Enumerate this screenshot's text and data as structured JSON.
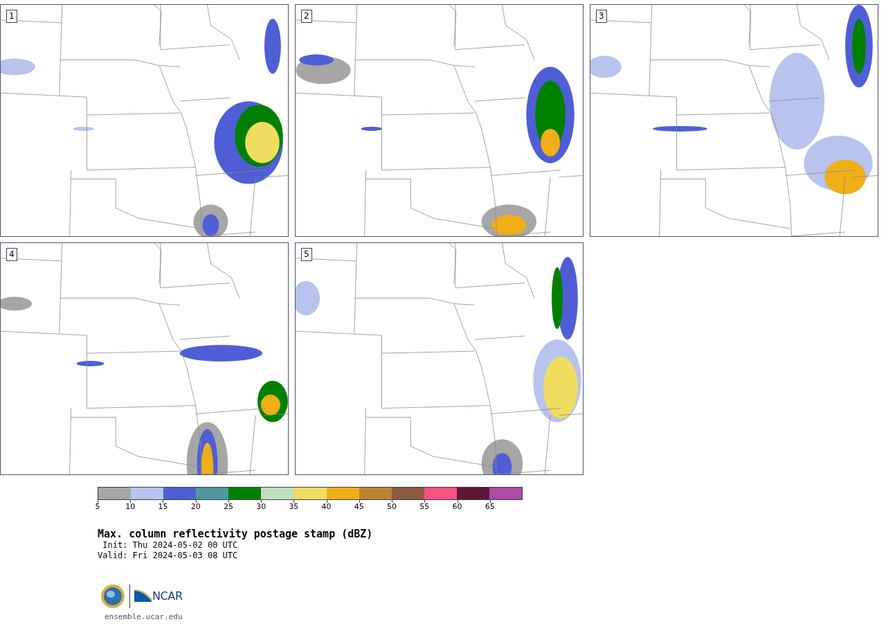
{
  "panels": [
    {
      "label": "1"
    },
    {
      "label": "2"
    },
    {
      "label": "3"
    },
    {
      "label": "4"
    },
    {
      "label": "5"
    }
  ],
  "colorbar": {
    "segments": [
      {
        "color": "#a6a6a6"
      },
      {
        "color": "#b8c3ee"
      },
      {
        "color": "#505ed6"
      },
      {
        "color": "#50979a"
      },
      {
        "color": "#008000"
      },
      {
        "color": "#bfdfbd"
      },
      {
        "color": "#f0dc5e"
      },
      {
        "color": "#f0ae17"
      },
      {
        "color": "#bd8430"
      },
      {
        "color": "#8c5b3e"
      },
      {
        "color": "#f75282"
      },
      {
        "color": "#5e1634"
      },
      {
        "color": "#ae4aa6"
      }
    ],
    "ticks": [
      "5",
      "10",
      "15",
      "20",
      "25",
      "30",
      "35",
      "40",
      "45",
      "50",
      "55",
      "60",
      "65"
    ]
  },
  "title": "Max. column reflectivity postage stamp (dBZ)",
  "init": " Init: Thu 2024-05-02 00 UTC",
  "valid": "Valid: Fri 2024-05-03 08 UTC",
  "logo_text": "NCAR",
  "site": "ensemble.ucar.edu"
}
